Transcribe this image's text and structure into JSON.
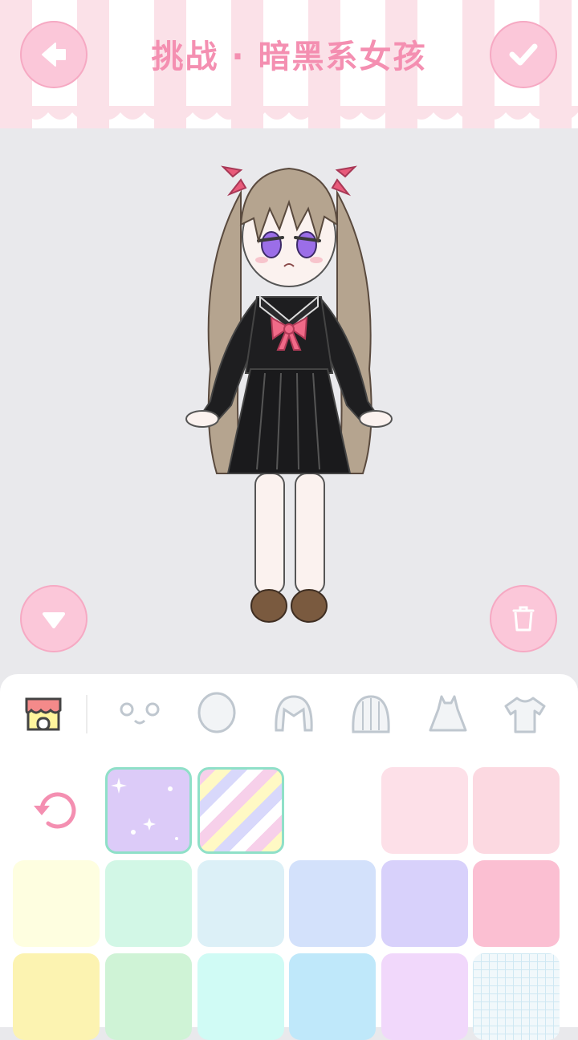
{
  "header": {
    "title": "挑战 · 暗黑系女孩"
  },
  "icons": {
    "back": "arrow-left-icon",
    "confirm": "checkmark-icon",
    "collapse": "triangle-down-icon",
    "trash": "trash-icon",
    "shop": "shop-icon",
    "face": "face-icon",
    "head": "head-icon",
    "hair_front": "hair-front-icon",
    "hair_back": "hair-back-icon",
    "dress": "dress-icon",
    "shirt": "shirt-icon",
    "reset": "reset-icon"
  },
  "colors": {
    "accent": "#f48fb1",
    "button_fill": "#fbc7d9",
    "selected_border": "#8fe0c8",
    "background": "#e9e9ec"
  },
  "swatches": [
    {
      "name": "reset",
      "color": ""
    },
    {
      "name": "pattern-purple-sparkles",
      "color": "#dccbf8",
      "selected": true
    },
    {
      "name": "pattern-pastel-chevron",
      "color": "#f7d0ea",
      "selected": true
    },
    {
      "name": "empty",
      "color": ""
    },
    {
      "name": "swatch-light-pink",
      "color": "#fde0e8"
    },
    {
      "name": "swatch-pink",
      "color": "#fcd9e1"
    },
    {
      "name": "swatch-cream",
      "color": "#fefee0"
    },
    {
      "name": "swatch-mint",
      "color": "#d2f7e6"
    },
    {
      "name": "swatch-light-blue",
      "color": "#dcf0f7"
    },
    {
      "name": "swatch-periwinkle",
      "color": "#d3e1fb"
    },
    {
      "name": "swatch-lavender",
      "color": "#d8d1fb"
    },
    {
      "name": "swatch-rose",
      "color": "#fbbfd2"
    },
    {
      "name": "swatch-yellow",
      "color": "#fcf3b1"
    },
    {
      "name": "swatch-green",
      "color": "#cff3d6"
    },
    {
      "name": "swatch-aqua",
      "color": "#d0fbf5"
    },
    {
      "name": "swatch-sky",
      "color": "#bfe8fa"
    },
    {
      "name": "swatch-lilac",
      "color": "#f1d8fb"
    },
    {
      "name": "swatch-grid",
      "color": "#f1f8fb"
    }
  ]
}
